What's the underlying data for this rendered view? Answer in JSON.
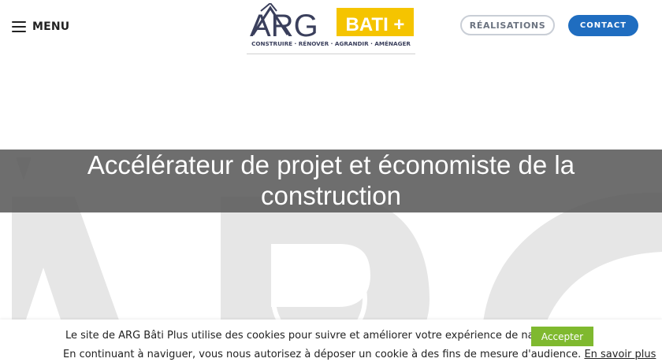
{
  "header": {
    "menu_label": "MENU",
    "logo": {
      "brand": "ARG",
      "badge": "BATI +",
      "tagline": "CONSTRUIRE · RÉNOVER · AGRANDIR · AMÉNAGER"
    },
    "realisations_label": "RÉALISATIONS",
    "contact_label": "CONTACT"
  },
  "hero": {
    "title_line1": "Accélérateur de projet et économiste de la",
    "title_line2": "construction"
  },
  "cookie_bar": {
    "line1": "Le site de ARG Bâti Plus utilise des cookies pour suivre et améliorer votre expérience de navigation",
    "accept_label": "Accepter",
    "line2": "En continuant à naviguer, vous nous autorisez à déposer un cookie à des fins de mesure d'audience.",
    "more_label": "En savoir plus"
  },
  "colors": {
    "contact_button": "#1f6dc0",
    "accept_button": "#7fb92f",
    "logo_yellow": "#f5c400",
    "logo_navy": "#3a3f5c"
  }
}
